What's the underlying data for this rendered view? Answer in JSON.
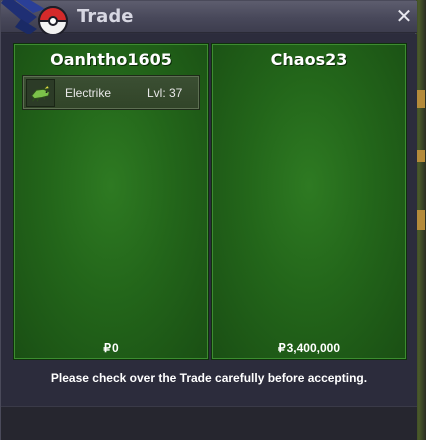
{
  "window": {
    "title": "Trade"
  },
  "trade": {
    "left": {
      "trainer": "Oanhtho1605",
      "items": [
        {
          "name": "Electrike",
          "level": "Lvl: 37"
        }
      ],
      "money_amount": "0"
    },
    "right": {
      "trainer": "Chaos23",
      "items": [],
      "money_amount": "3,400,000"
    },
    "currency_symbol": "₽"
  },
  "notice": "Please check over the Trade carefully before accepting.",
  "icons": {
    "close": "close-icon",
    "logo": "pokeball-logo-icon",
    "pokemon": "electrike-icon"
  },
  "colors": {
    "panel_green": "#23661a",
    "titlebar": "#48485a",
    "window_bg": "#2e2e3e"
  }
}
